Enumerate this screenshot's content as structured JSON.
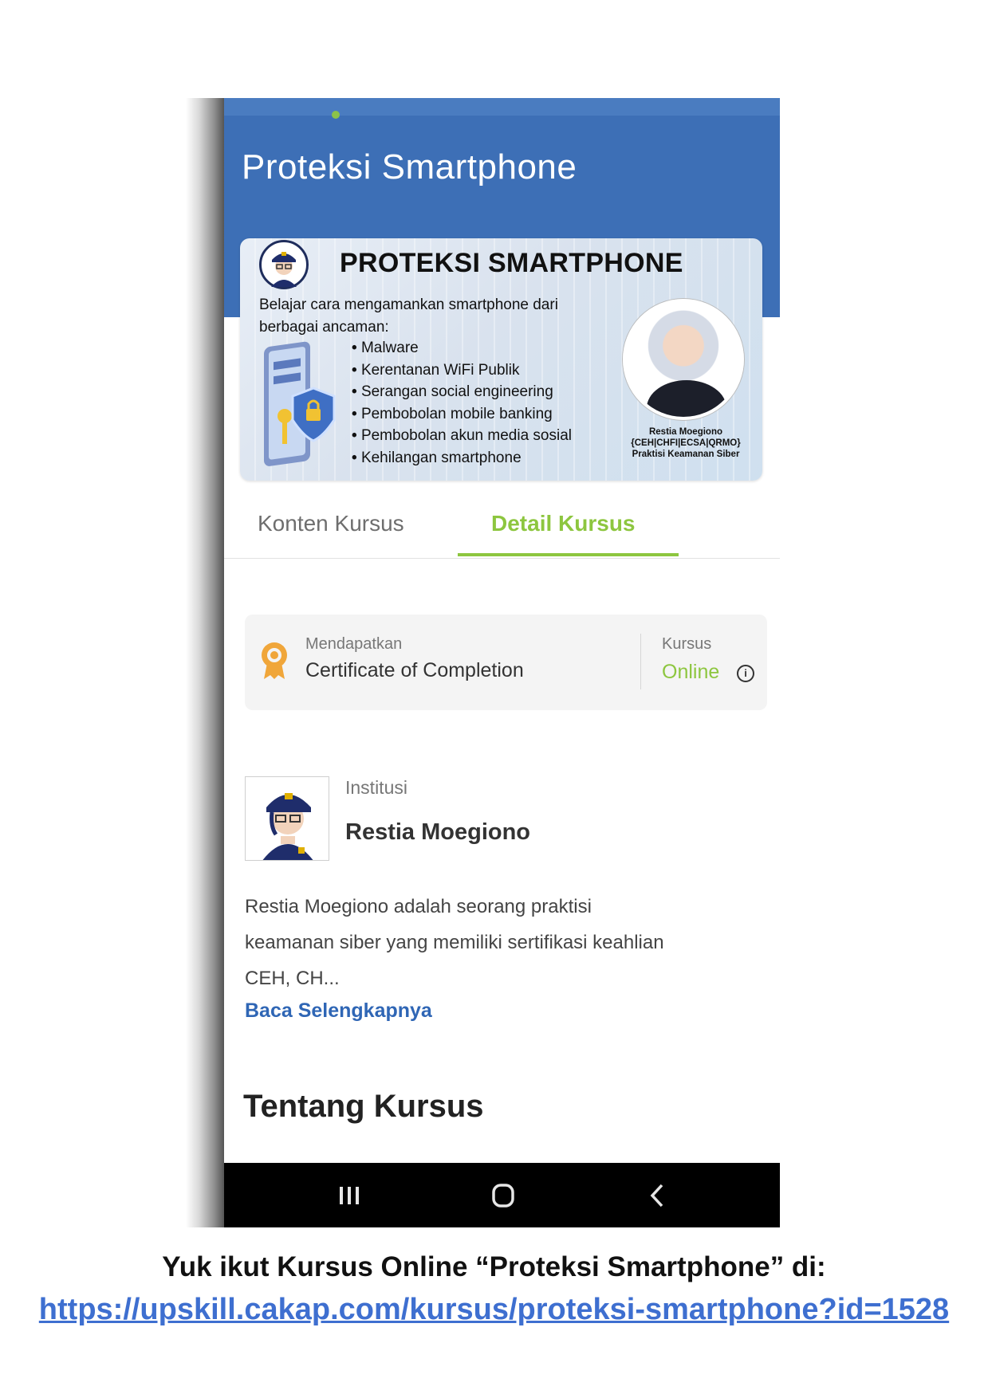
{
  "header": {
    "title": "Proteksi Smartphone"
  },
  "banner": {
    "title": "PROTEKSI SMARTPHONE",
    "intro": "Belajar cara mengamankan smartphone dari berbagai ancaman:",
    "threats": [
      "Malware",
      "Kerentanan WiFi Publik",
      "Serangan social engineering",
      "Pembobolan mobile banking",
      "Pembobolan akun media sosial",
      "Kehilangan smartphone"
    ],
    "speaker_name": "Restia Moegiono",
    "speaker_certs": "{CEH|CHFI|ECSA|QRMO}",
    "speaker_role": "Praktisi Keamanan Siber"
  },
  "tabs": {
    "content_label": "Konten Kursus",
    "detail_label": "Detail Kursus",
    "active": "Detail Kursus"
  },
  "info_card": {
    "earn_label": "Mendapatkan",
    "certificate": "Certificate of Completion",
    "mode_label": "Kursus",
    "mode_value": "Online"
  },
  "institution": {
    "label": "Institusi",
    "name": "Restia Moegiono",
    "description": "Restia Moegiono adalah seorang praktisi keamanan siber yang memiliki sertifikasi keahlian CEH, CH...",
    "read_more": "Baca Selengkapnya"
  },
  "about": {
    "heading": "Tentang Kursus"
  },
  "navigation": {
    "icons": [
      "recents-icon",
      "home-icon",
      "back-icon"
    ]
  },
  "cta": {
    "text": "Yuk ikut Kursus Online “Proteksi Smartphone” di:",
    "link": "https://upskill.cakap.com/kursus/proteksi-smartphone?id=1528"
  },
  "colors": {
    "header_blue": "#3d6fb6",
    "accent_green": "#8dc63f",
    "link_blue": "#2f66b5",
    "cta_link_blue": "#3e6fd0"
  }
}
